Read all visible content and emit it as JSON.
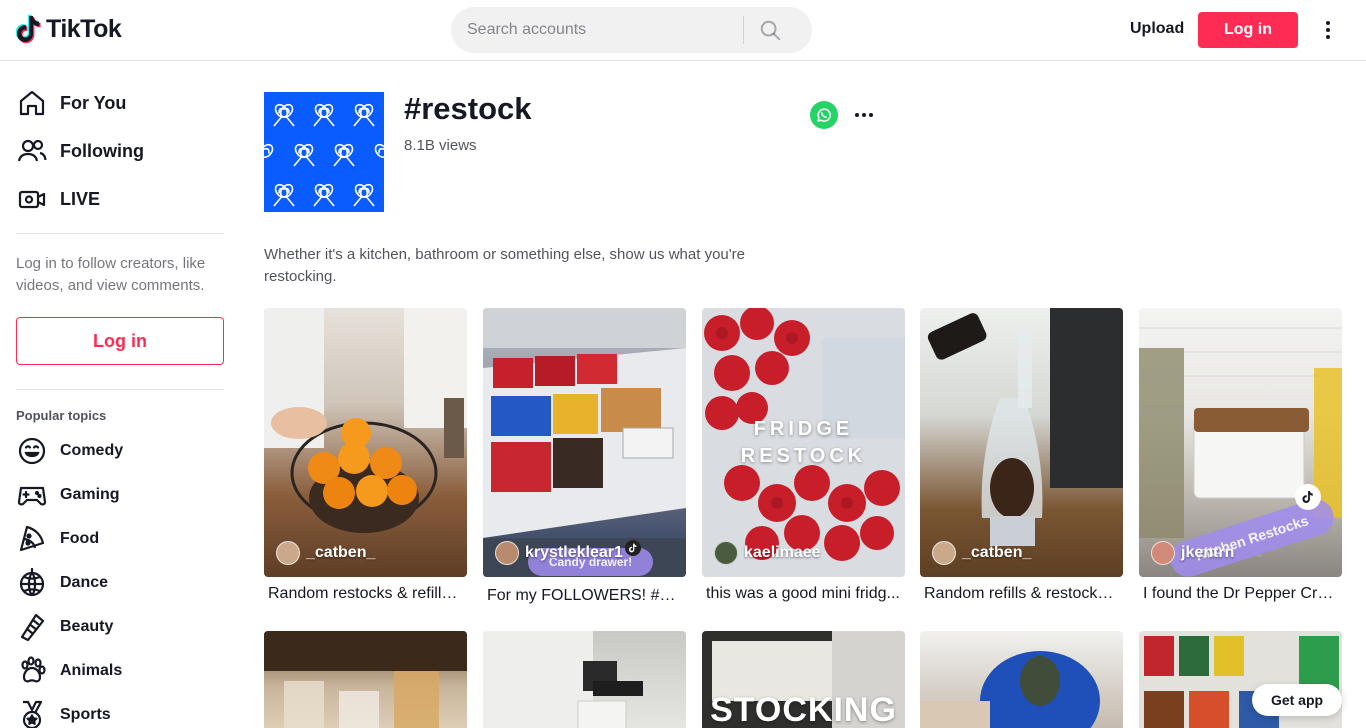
{
  "header": {
    "logo_text": "TikTok",
    "search_placeholder": "Search accounts",
    "upload_label": "Upload",
    "login_label": "Log in"
  },
  "sidebar": {
    "nav": [
      {
        "label": "For You",
        "icon": "home-icon"
      },
      {
        "label": "Following",
        "icon": "following-icon"
      },
      {
        "label": "LIVE",
        "icon": "live-icon"
      }
    ],
    "login_prompt": "Log in to follow creators, like videos, and view comments.",
    "login_label": "Log in",
    "topics_title": "Popular topics",
    "topics": [
      {
        "label": "Comedy",
        "icon": "comedy-icon"
      },
      {
        "label": "Gaming",
        "icon": "gaming-icon"
      },
      {
        "label": "Food",
        "icon": "food-icon"
      },
      {
        "label": "Dance",
        "icon": "dance-icon"
      },
      {
        "label": "Beauty",
        "icon": "beauty-icon"
      },
      {
        "label": "Animals",
        "icon": "animals-icon"
      },
      {
        "label": "Sports",
        "icon": "sports-icon"
      }
    ]
  },
  "hashtag": {
    "title": "#restock",
    "views": "8.1B views",
    "description": "Whether it's a kitchen, bathroom or something else, show us what you're restocking."
  },
  "videos": [
    {
      "author": "_catben_",
      "caption": "Random restocks & refills ..."
    },
    {
      "author": "krystleklear1",
      "caption": "For my FOLLOWERS! #▯ #...",
      "overlay": "Candy drawer!"
    },
    {
      "author": "kaelimaee",
      "caption": "this was a good mini fridg...",
      "overlay": "FRIDGE RESTOCK"
    },
    {
      "author": "_catben_",
      "caption": "Random refills & restocks ..."
    },
    {
      "author": "jkentrn",
      "caption": "I found the Dr Pepper Cre...",
      "overlay": "Kitchen Restocks"
    }
  ],
  "videos_row2": [
    {
      "overlay": ""
    },
    {
      "overlay": ""
    },
    {
      "overlay": "STOCKING"
    },
    {
      "overlay": ""
    },
    {
      "overlay": ""
    }
  ],
  "get_app_label": "Get app",
  "colors": {
    "brand": "#fe2c55",
    "hashtag_cover": "#0a5cff",
    "whatsapp": "#25d366"
  }
}
